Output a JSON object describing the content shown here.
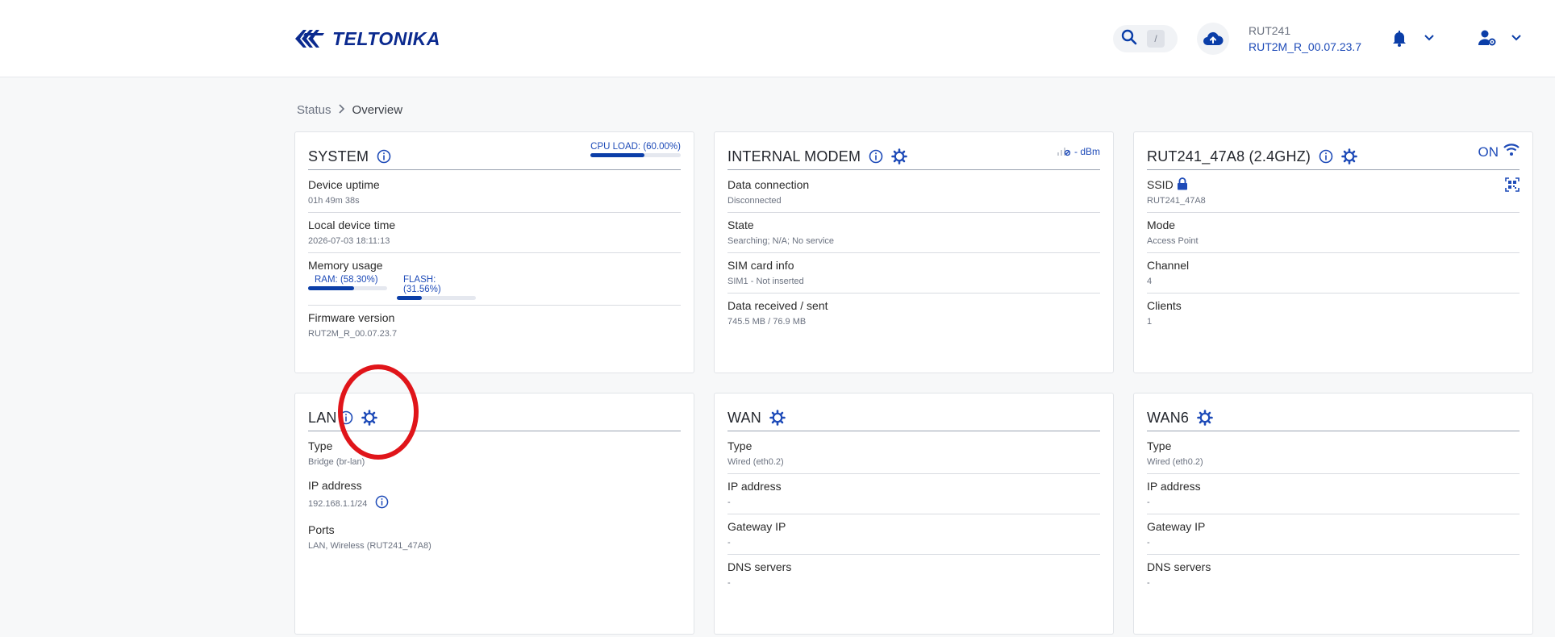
{
  "header": {
    "logo_text": "TELTONIKA",
    "search_shortcut": "/",
    "device_name": "RUT241",
    "device_firmware": "RUT2M_R_00.07.23.7"
  },
  "breadcrumb": {
    "parent": "Status",
    "current": "Overview"
  },
  "system": {
    "title": "SYSTEM",
    "cpu_label": "CPU LOAD: (60.00%)",
    "cpu_load": 0.6,
    "uptime_label": "Device uptime",
    "uptime_value": "01h 49m 38s",
    "time_label": "Local device time",
    "time_value": "2026-07-03 18:11:13",
    "memory_label": "Memory usage",
    "ram_label": "RAM: (58.30%)",
    "ram_usage": 0.583,
    "flash_label": "FLASH: (31.56%)",
    "flash_usage": 0.3156,
    "fw_label": "Firmware version",
    "fw_value": "RUT2M_R_00.07.23.7"
  },
  "modem": {
    "title": "INTERNAL MODEM",
    "signal_text": "- dBm",
    "rows": [
      {
        "label": "Data connection",
        "value": "Disconnected"
      },
      {
        "label": "State",
        "value": "Searching; N/A; No service"
      },
      {
        "label": "SIM card info",
        "value": "SIM1 - Not inserted"
      },
      {
        "label": "Data received / sent",
        "value": "745.5 MB / 76.9 MB"
      }
    ]
  },
  "wifi": {
    "title": "RUT241_47A8 (2.4GHZ)",
    "status": "ON",
    "ssid_label": "SSID",
    "ssid_value": "RUT241_47A8",
    "rows": [
      {
        "label": "Mode",
        "value": "Access Point"
      },
      {
        "label": "Channel",
        "value": "4"
      },
      {
        "label": "Clients",
        "value": "1"
      }
    ]
  },
  "lan": {
    "title": "LAN",
    "type_label": "Type",
    "type_value": "Bridge (br-lan)",
    "ip_label": "IP address",
    "ip_value": "192.168.1.1/24",
    "ports_label": "Ports",
    "ports_value": "LAN, Wireless (RUT241_47A8)"
  },
  "wan": {
    "title": "WAN",
    "rows": [
      {
        "label": "Type",
        "value": "Wired (eth0.2)"
      },
      {
        "label": "IP address",
        "value": "-"
      },
      {
        "label": "Gateway IP",
        "value": "-"
      },
      {
        "label": "DNS servers",
        "value": "-"
      }
    ]
  },
  "wan6": {
    "title": "WAN6",
    "rows": [
      {
        "label": "Type",
        "value": "Wired (eth0.2)"
      },
      {
        "label": "IP address",
        "value": "-"
      },
      {
        "label": "Gateway IP",
        "value": "-"
      },
      {
        "label": "DNS servers",
        "value": "-"
      }
    ]
  },
  "colors": {
    "accent": "#1e4bb8",
    "bar_fill": "#0b3ea8",
    "annotation": "#e0151a"
  }
}
